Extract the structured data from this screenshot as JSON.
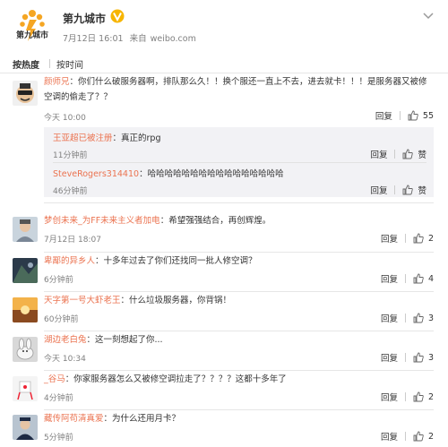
{
  "post": {
    "account": "第九城市",
    "logo_text": "第九城市",
    "date": "7月12日 16:01",
    "source_prefix": "来自",
    "source": "weibo.com"
  },
  "sort": {
    "hot": "按热度",
    "time": "按时间"
  },
  "actions": {
    "reply": "回复",
    "like": "赞"
  },
  "comments": [
    {
      "user": "颜师兄",
      "text": "：你们什么破服务器啊，排队那么久！！换个服还一直上不去，进去就卡！！！是服务器又被修空调的偷走了？？",
      "time": "今天 10:00",
      "likes": "55",
      "replies": [
        {
          "user": "王亚超已被注册",
          "text": "：真正的rpg",
          "time": "11分钟前"
        },
        {
          "user": "SteveRogers314410",
          "text": "：哈哈哈哈哈哈哈哈哈哈哈哈哈哈哈哈",
          "time": "46分钟前"
        }
      ]
    },
    {
      "user": "梦创未来_为FF未来主义者加电",
      "text": "：希望强强结合，再创辉煌。",
      "time": "7月12日 18:07",
      "likes": "2"
    },
    {
      "user": "卑鄙的异乡人",
      "text": "：十多年过去了你们还找同一批人修空调？",
      "time": "6分钟前",
      "likes": "4"
    },
    {
      "user": "天字第一号大虾老王",
      "text": "：什么垃圾服务器，你背锅！",
      "time": "60分钟前",
      "likes": "3"
    },
    {
      "user": "湖边老白兔",
      "text": "：这一刻想起了你...",
      "time": "今天 10:34",
      "likes": "3"
    },
    {
      "user": "_谷马",
      "text": "：你家服务器怎么又被修空调拉走了？？？？这都十多年了",
      "time": "4分钟前",
      "likes": "2"
    },
    {
      "user": "藏传阿苟清真爱",
      "text": "：为什么还用月卡？",
      "time": "5分钟前",
      "likes": "2"
    }
  ]
}
